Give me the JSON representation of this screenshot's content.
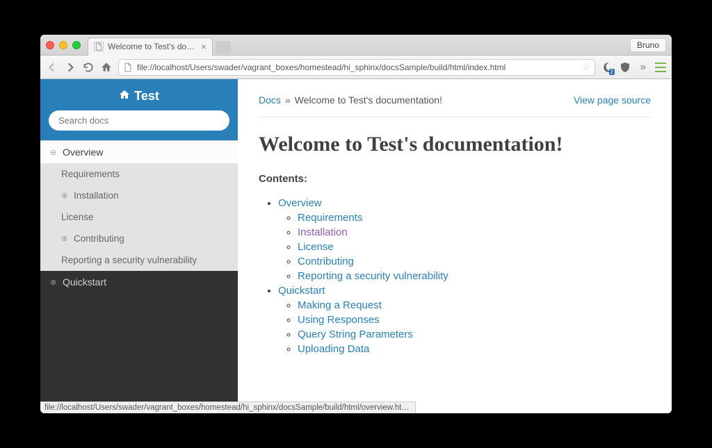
{
  "browser": {
    "tab_title": "Welcome to Test's docume",
    "profile_button": "Bruno",
    "url": "file://localhost/Users/swader/vagrant_boxes/homestead/hi_sphinx/docsSample/build/html/index.html",
    "ext_badge": "2",
    "status_text": "file://localhost/Users/swader/vagrant_boxes/homestead/hi_sphinx/docsSample/build/html/overview.html#lic"
  },
  "sidebar": {
    "project_name": "Test",
    "search_placeholder": "Search docs",
    "items": [
      {
        "label": "Overview",
        "level": 1,
        "current": true,
        "icon": "minus"
      },
      {
        "label": "Requirements",
        "level": 2
      },
      {
        "label": "Installation",
        "level": 2,
        "icon": "plus"
      },
      {
        "label": "License",
        "level": 2
      },
      {
        "label": "Contributing",
        "level": 2,
        "icon": "plus"
      },
      {
        "label": "Reporting a security vulnerability",
        "level": 2
      },
      {
        "label": "Quickstart",
        "level": 1,
        "dark": true,
        "icon": "plus"
      }
    ]
  },
  "content": {
    "breadcrumb_root": "Docs",
    "breadcrumb_sep": "»",
    "breadcrumb_current": "Welcome to Test's documentation!",
    "view_source": "View page source",
    "heading": "Welcome to Test's documentation!",
    "contents_label": "Contents:",
    "toc": [
      {
        "label": "Overview",
        "children": [
          {
            "label": "Requirements"
          },
          {
            "label": "Installation",
            "visited": true
          },
          {
            "label": "License"
          },
          {
            "label": "Contributing"
          },
          {
            "label": "Reporting a security vulnerability"
          }
        ]
      },
      {
        "label": "Quickstart",
        "children": [
          {
            "label": "Making a Request"
          },
          {
            "label": "Using Responses"
          },
          {
            "label": "Query String Parameters"
          },
          {
            "label": "Uploading Data"
          }
        ]
      }
    ]
  }
}
